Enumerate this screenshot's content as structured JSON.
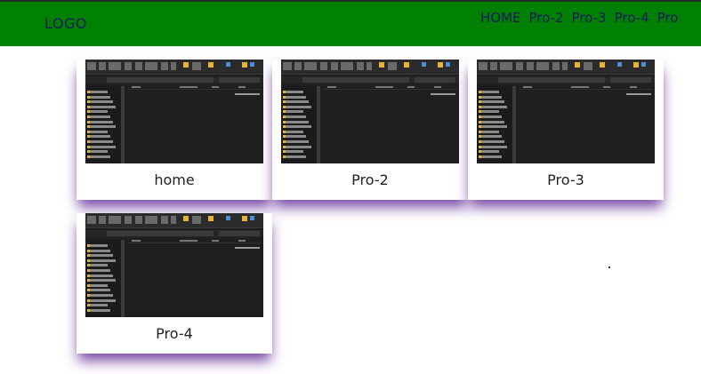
{
  "header": {
    "logo": "LOGO",
    "nav": [
      "HOME",
      "Pro-2",
      "Pro-3",
      "Pro-4",
      "Pro"
    ]
  },
  "cards": [
    {
      "label": "home"
    },
    {
      "label": "Pro-2"
    },
    {
      "label": "Pro-3"
    },
    {
      "label": "Pro-4"
    }
  ],
  "colors": {
    "navbar": "#008000",
    "nav_text": "#1a1a5e",
    "card_shadow": "#663399",
    "thumbnail_bg": "#1f1f1f"
  },
  "icons": {
    "thumbnail": "file-explorer-screenshot"
  }
}
